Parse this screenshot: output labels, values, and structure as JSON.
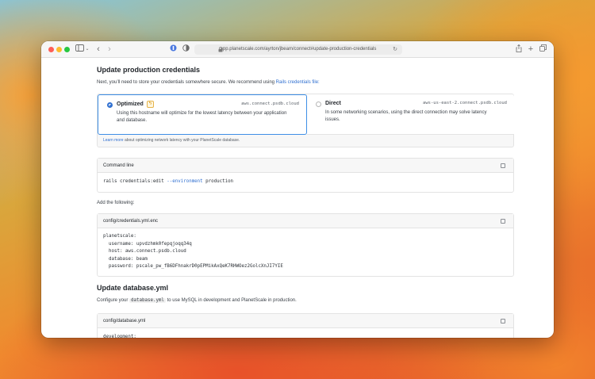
{
  "browser": {
    "url": "app.planetscale.com/ayrton/jbeam/connect#update-production-credentials"
  },
  "section1": {
    "title": "Update production credentials",
    "intro": "Next, you’ll need to store your credentials somewhere secure. We recommend using ",
    "intro_link": "Rails credentials file:",
    "options": [
      {
        "name": "Optimized",
        "host": "aws.connect.psdb.cloud",
        "desc": "Using this hostname will optimize for the lowest latency between your application and database.",
        "selected": true
      },
      {
        "name": "Direct",
        "host": "aws-us-east-2.connect.psdb.cloud",
        "desc": "In some networking scenarios, using the direct connection may solve latency issues.",
        "selected": false
      }
    ],
    "learn_link": "Learn more",
    "learn_text": " about optimizing network latency with your PlanetScale database."
  },
  "command_panel": {
    "title": "Command line",
    "cmd_prefix": "rails credentials:edit ",
    "cmd_flag": "--environment",
    "cmd_suffix": " production"
  },
  "add_following": "Add the following:",
  "credentials_panel": {
    "title": "config/credentials.yml.enc",
    "code": "planetscale:\n  username: upvdzhmk0fepqjoqq34q\n  host: aws.connect.psdb.cloud\n  database: beam\n  password: pscale_pw_fB6DFhnakrD0pEPMikAxQeK7RHWOez2GolcXnJI7YIE"
  },
  "section2": {
    "title": "Update database.yml",
    "configure_prefix": "Configure your ",
    "configure_code": "database.yml",
    "configure_suffix": " to use MySQL in development and PlanetScale in production."
  },
  "database_panel": {
    "title": "config/database.yml",
    "code": "development:"
  },
  "colors": {
    "accent": "#2f6fd0",
    "selected_border": "#3f8fe6"
  }
}
